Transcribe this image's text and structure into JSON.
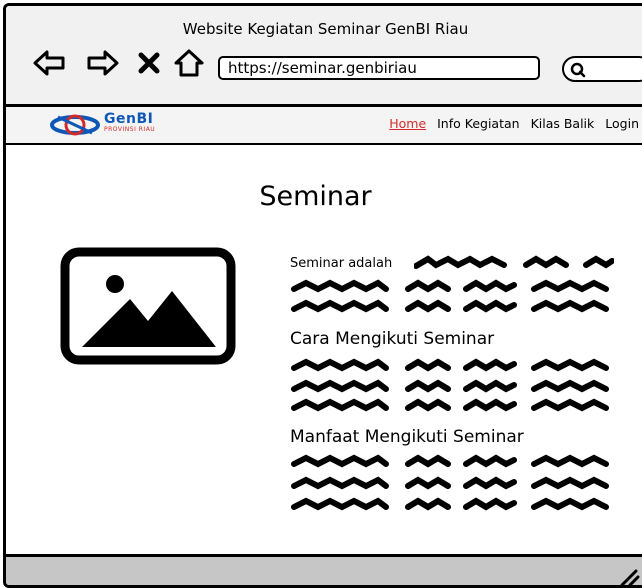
{
  "window": {
    "title": "Website Kegiatan Seminar GenBI Riau"
  },
  "browser": {
    "url": "https://seminar.genbiriau",
    "icons": [
      "back-arrow-icon",
      "forward-arrow-icon",
      "close-icon",
      "home-icon",
      "search-icon"
    ]
  },
  "site": {
    "logo_name": "GenBI",
    "logo_sub": "PROVINSI RIAU",
    "menu": [
      {
        "label": "Home",
        "active": true
      },
      {
        "label": "Info Kegiatan",
        "active": false
      },
      {
        "label": "Kilas Balik",
        "active": false
      },
      {
        "label": "Login",
        "active": false
      }
    ]
  },
  "main": {
    "title": "Seminar",
    "intro_label": "Seminar adalah",
    "sections": [
      {
        "heading": "Cara Mengikuti Seminar"
      },
      {
        "heading": "Manfaat Mengikuti Seminar"
      }
    ]
  },
  "colors": {
    "active_link": "#d32f2f",
    "logo_blue": "#0f57b7",
    "chrome_bg": "#f1f1f1",
    "footer_bg": "#c6c6c6"
  }
}
